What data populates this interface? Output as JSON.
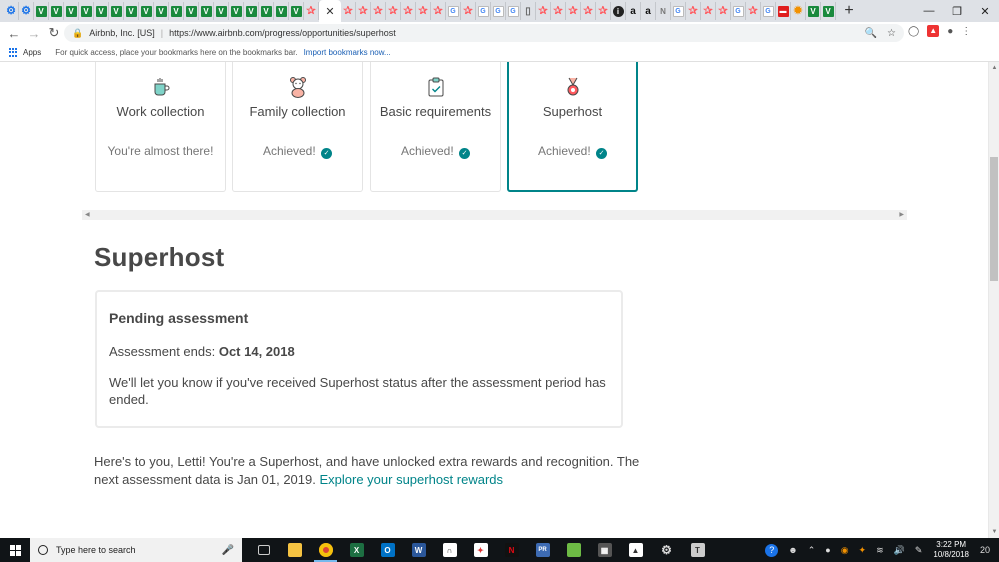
{
  "browser": {
    "tab_favicons": [
      "gear",
      "gear",
      "V",
      "V",
      "V",
      "V",
      "V",
      "V",
      "V",
      "V",
      "V",
      "V",
      "V",
      "V",
      "V",
      "V",
      "V",
      "V",
      "V",
      "V",
      "air",
      "ACTIVE",
      "air",
      "air",
      "air",
      "air",
      "air",
      "air",
      "air",
      "G",
      "air",
      "G",
      "G",
      "G",
      "doc",
      "air",
      "air",
      "air",
      "air",
      "air",
      "dark",
      "amz",
      "amz",
      "n",
      "G",
      "air",
      "air",
      "air",
      "G",
      "air",
      "G",
      "red",
      "ora",
      "V",
      "V"
    ],
    "active_tab_close": "✕",
    "new_tab": "+",
    "window_controls": [
      "—",
      "❐",
      "✕"
    ],
    "site_identity": "Airbnb, Inc. [US]",
    "url": "https://www.airbnb.com/progress/opportunities/superhost",
    "bookmarks_apps": "Apps",
    "bookmarks_hint": "For quick access, place your bookmarks here on the bookmarks bar.",
    "bookmarks_import": "Import bookmarks now..."
  },
  "cards": [
    {
      "title": "Work collection",
      "status": "You're almost there!",
      "achieved": false,
      "icon": "mug-icon"
    },
    {
      "title": "Family collection",
      "status": "Achieved!",
      "achieved": true,
      "icon": "teddy-bear-icon"
    },
    {
      "title": "Basic requirements",
      "status": "Achieved!",
      "achieved": true,
      "icon": "clipboard-icon"
    },
    {
      "title": "Superhost",
      "status": "Achieved!",
      "achieved": true,
      "icon": "medal-icon",
      "selected": true
    }
  ],
  "section_title": "Superhost",
  "assessment": {
    "title": "Pending assessment",
    "ends_label": "Assessment ends:",
    "ends_date": "Oct 14, 2018",
    "body": "We'll let you know if you've received Superhost status after the assessment period has ended."
  },
  "footer": {
    "text": "Here's to you, Letti! You're a Superhost, and have unlocked extra rewards and recognition. The next assessment data is Jan 01, 2019.",
    "link": "Explore your superhost rewards"
  },
  "taskbar": {
    "search_placeholder": "Type here to search",
    "time": "3:22 PM",
    "date": "10/8/2018",
    "notifications": "20"
  },
  "colors": {
    "teal": "#008489",
    "airbnb_red": "#ff5a5f",
    "text": "#484848",
    "taskbar": "#101417"
  }
}
